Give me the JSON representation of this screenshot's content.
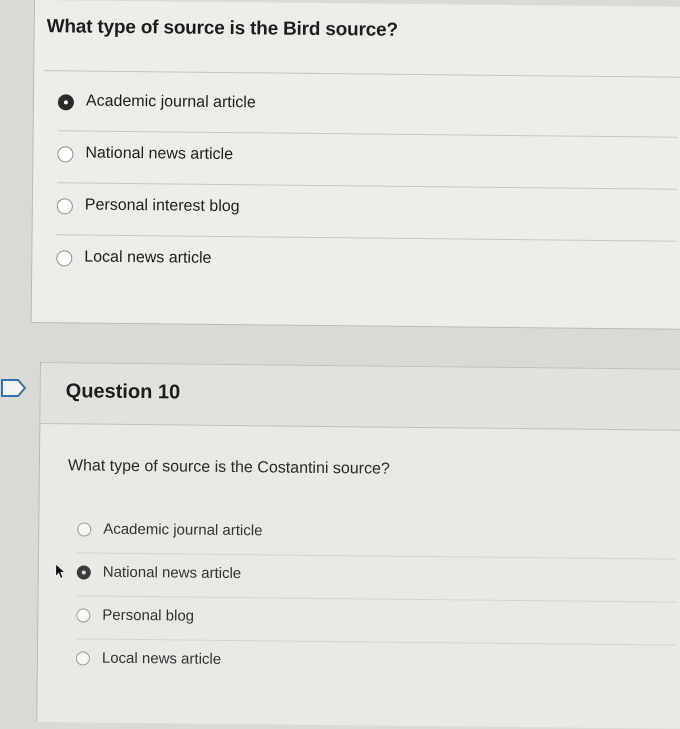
{
  "question_prev": {
    "prompt": "What type of source is the Bird source?",
    "options": [
      {
        "label": "Academic journal article",
        "selected": true
      },
      {
        "label": "National news article",
        "selected": false
      },
      {
        "label": "Personal interest blog",
        "selected": false
      },
      {
        "label": "Local news article",
        "selected": false
      }
    ]
  },
  "question_10": {
    "title": "Question 10",
    "prompt": "What type of source is the Costantini source?",
    "options": [
      {
        "label": "Academic journal article",
        "selected": false
      },
      {
        "label": "National news article",
        "selected": true
      },
      {
        "label": "Personal blog",
        "selected": false
      },
      {
        "label": "Local news article",
        "selected": false
      }
    ]
  },
  "icons": {
    "flag": "flag-outline-icon",
    "cursor": "mouse-pointer-icon"
  }
}
